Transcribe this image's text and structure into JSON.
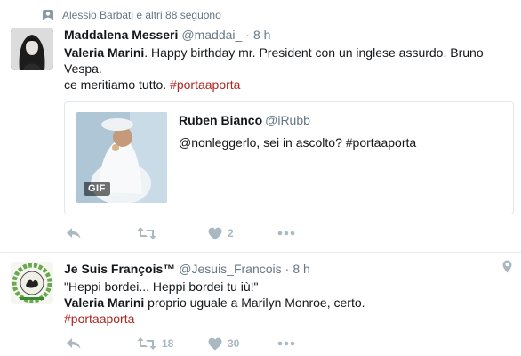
{
  "colors": {
    "hashtag": "#b0251f",
    "muted": "#657786",
    "action": "#aab8c2",
    "border": "#e6ecf0"
  },
  "context": {
    "icon": "follow-icon",
    "text": "Alessio Barbati e altri 88 seguono"
  },
  "tweet1": {
    "name": "Maddalena Messeri",
    "handle": "@maddai_",
    "separator": "·",
    "time": "8 h",
    "mention": "Valeria Marini",
    "body_rest": ". Happy birthday mr. President con un inglese assurdo. Bruno Vespa.",
    "line2": "ce meritiamo tutto. ",
    "hashtag": "#portaaporta",
    "quote": {
      "name": "Ruben Bianco",
      "handle": "@iRubb",
      "text": "@nonleggerlo, sei in ascolto? #portaaporta",
      "media_badge": "GIF"
    },
    "actions": {
      "reply_icon": "reply-icon",
      "retweet_icon": "retweet-icon",
      "retweet_count": "",
      "like_icon": "heart-icon",
      "like_count": "2",
      "more_icon": "more-icon"
    }
  },
  "tweet2": {
    "name": "Je Suis François™",
    "handle": "@Jesuis_Francois",
    "separator": "·",
    "time": "8 h",
    "line1": "\"Heppi bordei... Heppi bordei tu iù!\"",
    "mention": "Valeria Marini",
    "line2_rest": " proprio uguale a Marilyn Monroe, certo.",
    "hashtag": "#portaaporta",
    "actions": {
      "reply_icon": "reply-icon",
      "retweet_icon": "retweet-icon",
      "retweet_count": "18",
      "like_icon": "heart-icon",
      "like_count": "30",
      "more_icon": "more-icon"
    },
    "geo_icon": "location-pin-icon"
  }
}
